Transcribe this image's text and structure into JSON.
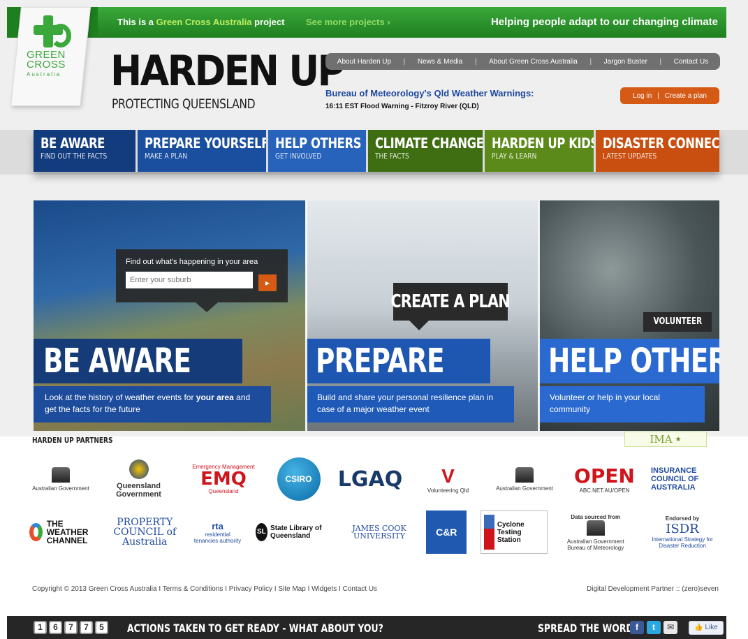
{
  "topbar": {
    "prefix": "This is a",
    "org_link": "Green Cross Australia",
    "suffix": "project",
    "see_more": "See more projects ›",
    "tagline": "Helping people adapt to our changing climate"
  },
  "logo": {
    "line1": "GREEN",
    "line2": "CROSS",
    "line3": "Australia"
  },
  "brand": {
    "title": "HARDEN UP",
    "subtitle": "PROTECTING QUEENSLAND"
  },
  "util_nav": [
    "About Harden Up",
    "News & Media",
    "About Green Cross Australia",
    "Jargon Buster",
    "Contact Us"
  ],
  "bom": {
    "title": "Bureau of Meteorology's Qld Weather Warnings:",
    "warning": "16:11 EST Flood Warning - Fitzroy River (QLD)"
  },
  "auth": {
    "login": "Log in",
    "create": "Create a plan"
  },
  "main_nav": [
    {
      "title": "BE AWARE",
      "sub": "FIND OUT THE FACTS",
      "color": "#123c7d"
    },
    {
      "title": "PREPARE YOURSELF",
      "sub": "MAKE A PLAN",
      "color": "#1a4f9f"
    },
    {
      "title": "HELP OTHERS",
      "sub": "GET INVOLVED",
      "color": "#2762bb"
    },
    {
      "title": "CLIMATE CHANGE",
      "sub": "THE FACTS",
      "color": "#3e6d12"
    },
    {
      "title": "HARDEN UP KIDS",
      "sub": "PLAY & LEARN",
      "color": "#5b8a1a"
    },
    {
      "title": "DISASTER CONNECT",
      "sub": "LATEST UPDATES",
      "color": "#c84f10"
    }
  ],
  "hero": {
    "search_label": "Find out what's happening in your area",
    "search_placeholder": "Enter your suburb",
    "create_plan": "CREATE A PLAN",
    "volunteer": "VOLUNTEER",
    "panels": [
      {
        "title": "BE AWARE",
        "desc_pre": "Look at the history of weather events for ",
        "desc_bold": "your area",
        "desc_post": " and get the facts for the future"
      },
      {
        "title": "PREPARE",
        "desc": "Build and share your personal resilience plan in case of a major weather event"
      },
      {
        "title": "HELP OTHERS",
        "desc": "Volunteer or help in your local community"
      }
    ]
  },
  "partners": {
    "heading": "HARDEN UP PARTNERS",
    "ima": "IMA",
    "row1": {
      "ag_ema": "Australian Government",
      "qld_gov": "Queensland Government",
      "emq_top": "Emergency Management",
      "emq": "EMQ",
      "emq_bottom": "Queensland",
      "csiro": "CSIRO",
      "lgaq": "LGAQ",
      "volunteering": "Volunteering Qld",
      "ag_dccee": "Australian Government",
      "open": "OPEN",
      "open_sub": "ABC.NET.AU/OPEN",
      "insurance": "INSURANCE COUNCIL OF AUSTRALIA"
    },
    "row2": {
      "weather_channel": "THE WEATHER CHANNEL",
      "property_council": "PROPERTY COUNCIL of Australia",
      "rta": "rta",
      "rta_sub": "residential tenancies authority",
      "sl": "SL",
      "state_library": "State Library of Queensland",
      "jcu": "JAMES COOK UNIVERSITY",
      "cr": "C&R",
      "cyclone": "Cyclone Testing Station",
      "bom_caption": "Data sourced from",
      "bom_name": "Australian Government Bureau of Meteorology",
      "isdr_caption": "Endorsed by",
      "isdr": "ISDR",
      "isdr_sub": "International Strategy for Disaster Reduction"
    }
  },
  "footer": {
    "copyright": "Copyright © 2013 Green Cross Australia I Terms & Conditions I Privacy Policy I Site Map I Widgets I Contact Us",
    "dev_partner": "Digital Development Partner :: (zero)seven"
  },
  "bottom_bar": {
    "counter_digits": [
      "1",
      "6",
      "7",
      "7",
      "5"
    ],
    "actions_text": "ACTIONS TAKEN TO GET READY - WHAT ABOUT YOU?",
    "spread": "SPREAD THE WORD",
    "like": "Like"
  },
  "colors": {
    "brand_green": "#3aa83a",
    "accent_orange": "#d45a16",
    "hero_blue": "#1e4c9c"
  }
}
